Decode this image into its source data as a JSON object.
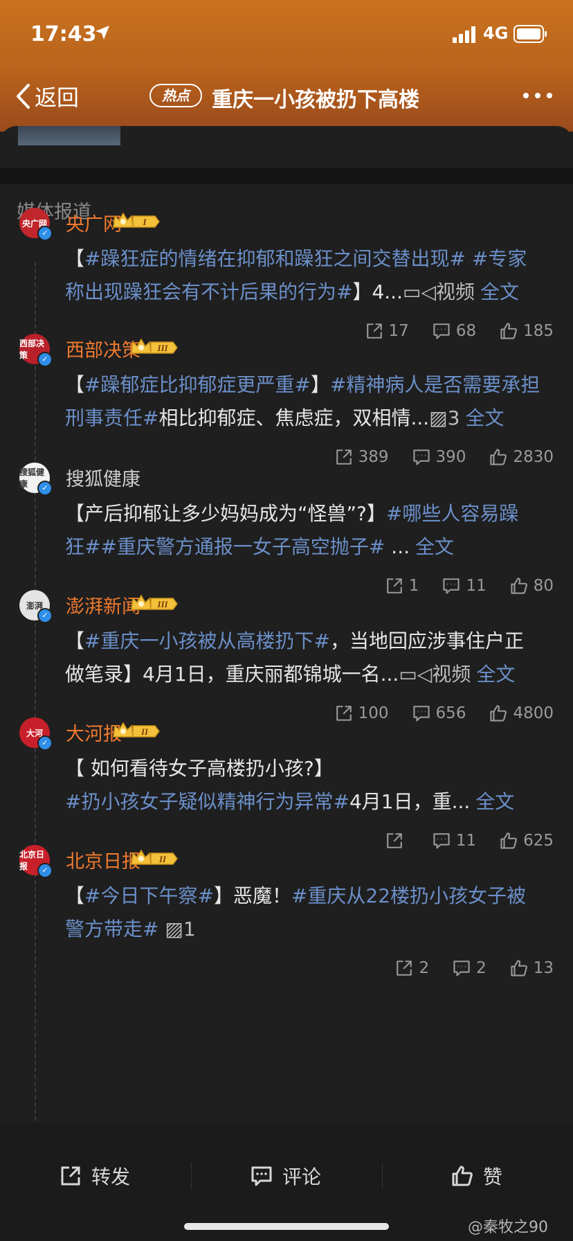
{
  "status_bar": {
    "time": "17:43",
    "network": "4G"
  },
  "nav": {
    "back_label": "返回",
    "badge": "热点",
    "title": "重庆一小孩被扔下高楼"
  },
  "section_title": "媒体报道",
  "posts": [
    {
      "source": "央广网",
      "rank": "I",
      "avatar_text": "央广网",
      "avatar_color": "#c0262b",
      "lines": [
        [
          {
            "t": "【",
            "c": "n"
          },
          {
            "t": "#躁狂症的情绪在抑郁和躁狂之间交替出现#",
            "c": "tag"
          },
          {
            "t": " ",
            "c": "n"
          },
          {
            "t": "#专家",
            "c": "tag"
          }
        ],
        [
          {
            "t": "称出现躁狂会有不计后果的行为#",
            "c": "tag"
          },
          {
            "t": "】4...",
            "c": "n"
          },
          {
            "t": "▭◁视频",
            "c": "media"
          },
          {
            "t": "全文",
            "c": "quan"
          }
        ]
      ],
      "repost": "17",
      "comment": "68",
      "like": "185"
    },
    {
      "source": "西部决策",
      "rank": "III",
      "avatar_text": "西部决策",
      "avatar_color": "#b8202a",
      "lines": [
        [
          {
            "t": "【",
            "c": "n"
          },
          {
            "t": "#躁郁症比抑郁症更严重#",
            "c": "tag"
          },
          {
            "t": "】",
            "c": "n"
          },
          {
            "t": "#精神病人是否需要承担",
            "c": "tag"
          }
        ],
        [
          {
            "t": "刑事责任#",
            "c": "tag"
          },
          {
            "t": "相比抑郁症、焦虑症，双相情...",
            "c": "n"
          },
          {
            "t": "▨3",
            "c": "media"
          },
          {
            "t": "全文",
            "c": "quan"
          }
        ]
      ],
      "repost": "389",
      "comment": "390",
      "like": "2830"
    },
    {
      "source": "搜狐健康",
      "rank": "",
      "avatar_text": "搜狐健康",
      "avatar_color": "#f2f2f2",
      "lines": [
        [
          {
            "t": "【产后抑郁让多少妈妈成为“怪兽”?】",
            "c": "n"
          },
          {
            "t": "#哪些人容易躁",
            "c": "tag"
          }
        ],
        [
          {
            "t": "狂##重庆警方通报一女子高空抛子#",
            "c": "tag"
          },
          {
            "t": " ...",
            "c": "n"
          },
          {
            "t": "全文",
            "c": "quan"
          }
        ]
      ],
      "repost": "1",
      "comment": "11",
      "like": "80"
    },
    {
      "source": "澎湃新闻",
      "rank": "III",
      "avatar_text": "澎湃",
      "avatar_color": "#e4e4e4",
      "lines": [
        [
          {
            "t": "【",
            "c": "n"
          },
          {
            "t": "#重庆一小孩被从高楼扔下#",
            "c": "tag"
          },
          {
            "t": "，当地回应涉事住户正",
            "c": "n"
          }
        ],
        [
          {
            "t": "做笔录】4月1日，重庆丽都锦城一名...",
            "c": "n"
          },
          {
            "t": "▭◁视频",
            "c": "media"
          },
          {
            "t": "全文",
            "c": "quan"
          }
        ]
      ],
      "repost": "100",
      "comment": "656",
      "like": "4800"
    },
    {
      "source": "大河报",
      "rank": "II",
      "avatar_text": "大河",
      "avatar_color": "#c8202a",
      "lines": [
        [
          {
            "t": "【 如何看待女子高楼扔小孩?】",
            "c": "n"
          }
        ],
        [
          {
            "t": "#扔小孩女子疑似精神行为异常#",
            "c": "tag"
          },
          {
            "t": "4月1日，重...",
            "c": "n"
          },
          {
            "t": "全文",
            "c": "quan"
          }
        ]
      ],
      "repost": "",
      "comment": "11",
      "like": "625"
    },
    {
      "source": "北京日报",
      "rank": "II",
      "avatar_text": "北京日报",
      "avatar_color": "#c8202a",
      "lines": [
        [
          {
            "t": "【",
            "c": "n"
          },
          {
            "t": "#今日下午察#",
            "c": "tag"
          },
          {
            "t": "】恶魔！",
            "c": "n"
          },
          {
            "t": "#重庆从22楼扔小孩女子被",
            "c": "tag"
          }
        ],
        [
          {
            "t": "警方带走#",
            "c": "tag"
          },
          {
            "t": " ▨1",
            "c": "media"
          }
        ]
      ],
      "repost": "2",
      "comment": "2",
      "like": "13"
    }
  ],
  "bottom_bar": {
    "repost": "转发",
    "comment": "评论",
    "like": "赞"
  },
  "watermark": "@秦牧之90"
}
